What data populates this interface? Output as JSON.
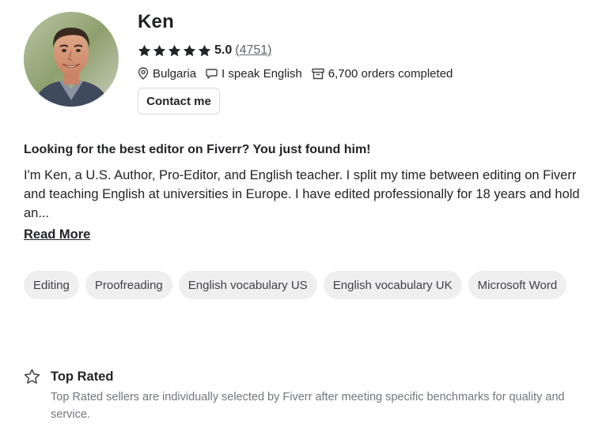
{
  "seller": {
    "name": "Ken",
    "rating": "5.0",
    "reviews": "4751",
    "country": "Bulgaria",
    "language": "I speak English",
    "orders": "6,700 orders completed"
  },
  "actions": {
    "contact_label": "Contact me",
    "read_more_label": "Read More"
  },
  "about": {
    "headline": "Looking for the best editor on Fiverr? You just found him!",
    "bio": "I'm Ken, a U.S. Author, Pro-Editor, and English teacher. I split my time between editing on Fiverr and teaching English at universities in Europe. I have edited professionally for 18 years and hold an..."
  },
  "skills": [
    "Editing",
    "Proofreading",
    "English vocabulary US",
    "English vocabulary UK",
    "Microsoft Word"
  ],
  "badge": {
    "title": "Top Rated",
    "description": "Top Rated sellers are individually selected by Fiverr after meeting specific benchmarks for quality and service."
  },
  "colors": {
    "text": "#222325",
    "muted": "#74767e",
    "chip_bg": "#efeff0",
    "border": "#dadbdd"
  },
  "icons": [
    "star-icon",
    "location-pin-icon",
    "speech-bubble-icon",
    "box-icon",
    "star-outline-icon"
  ]
}
